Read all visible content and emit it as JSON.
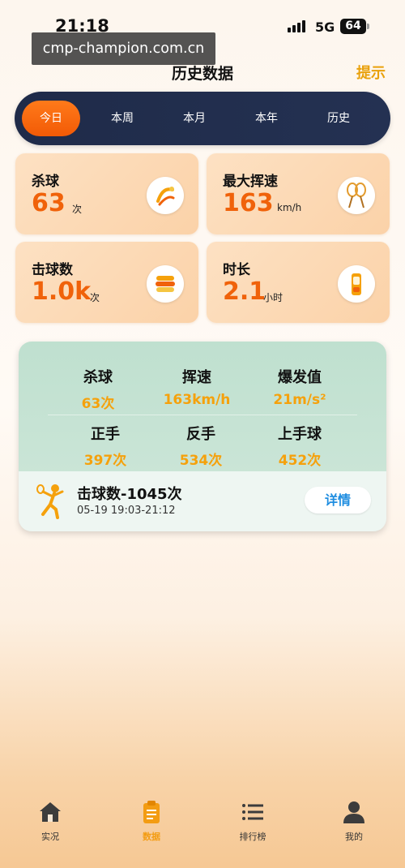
{
  "status_bar": {
    "time": "21:18",
    "network": "5G",
    "battery": "64"
  },
  "watermark": "cmp-champion.com.cn",
  "header": {
    "title": "历史数据",
    "hint_label": "提示"
  },
  "tabs": [
    {
      "label": "今日",
      "active": true
    },
    {
      "label": "本周",
      "active": false
    },
    {
      "label": "本月",
      "active": false
    },
    {
      "label": "本年",
      "active": false
    },
    {
      "label": "历史",
      "active": false
    }
  ],
  "stats": [
    {
      "label": "杀球",
      "value": "63",
      "unit": "次",
      "icon": "smash-icon"
    },
    {
      "label": "最大挥速",
      "value": "163",
      "unit": "km/h",
      "icon": "rackets-icon"
    },
    {
      "label": "击球数",
      "value": "1.0k",
      "unit": "次",
      "icon": "shuttle-count-icon"
    },
    {
      "label": "时长",
      "value": "2.1",
      "unit": "小时",
      "icon": "timer-icon"
    }
  ],
  "summary": {
    "metrics": [
      {
        "label": "杀球",
        "value": "63次"
      },
      {
        "label": "挥速",
        "value": "163km/h"
      },
      {
        "label": "爆发值",
        "value": "21m/s²"
      },
      {
        "label": "正手",
        "value": "397次"
      },
      {
        "label": "反手",
        "value": "534次"
      },
      {
        "label": "上手球",
        "value": "452次"
      }
    ],
    "title": "击球数-1045次",
    "time_range": "05-19 19:03-21:12",
    "details_label": "详情"
  },
  "colors": {
    "accent": "#f0620a",
    "highlight": "#f5a10c",
    "tab_bg": "#1f2b49",
    "link": "#1e8de0"
  },
  "nav": [
    {
      "label": "实况",
      "icon": "home-icon",
      "active": false
    },
    {
      "label": "数据",
      "icon": "clipboard-icon",
      "active": true
    },
    {
      "label": "排行榜",
      "icon": "ranking-list-icon",
      "active": false
    },
    {
      "label": "我的",
      "icon": "profile-icon",
      "active": false
    }
  ]
}
